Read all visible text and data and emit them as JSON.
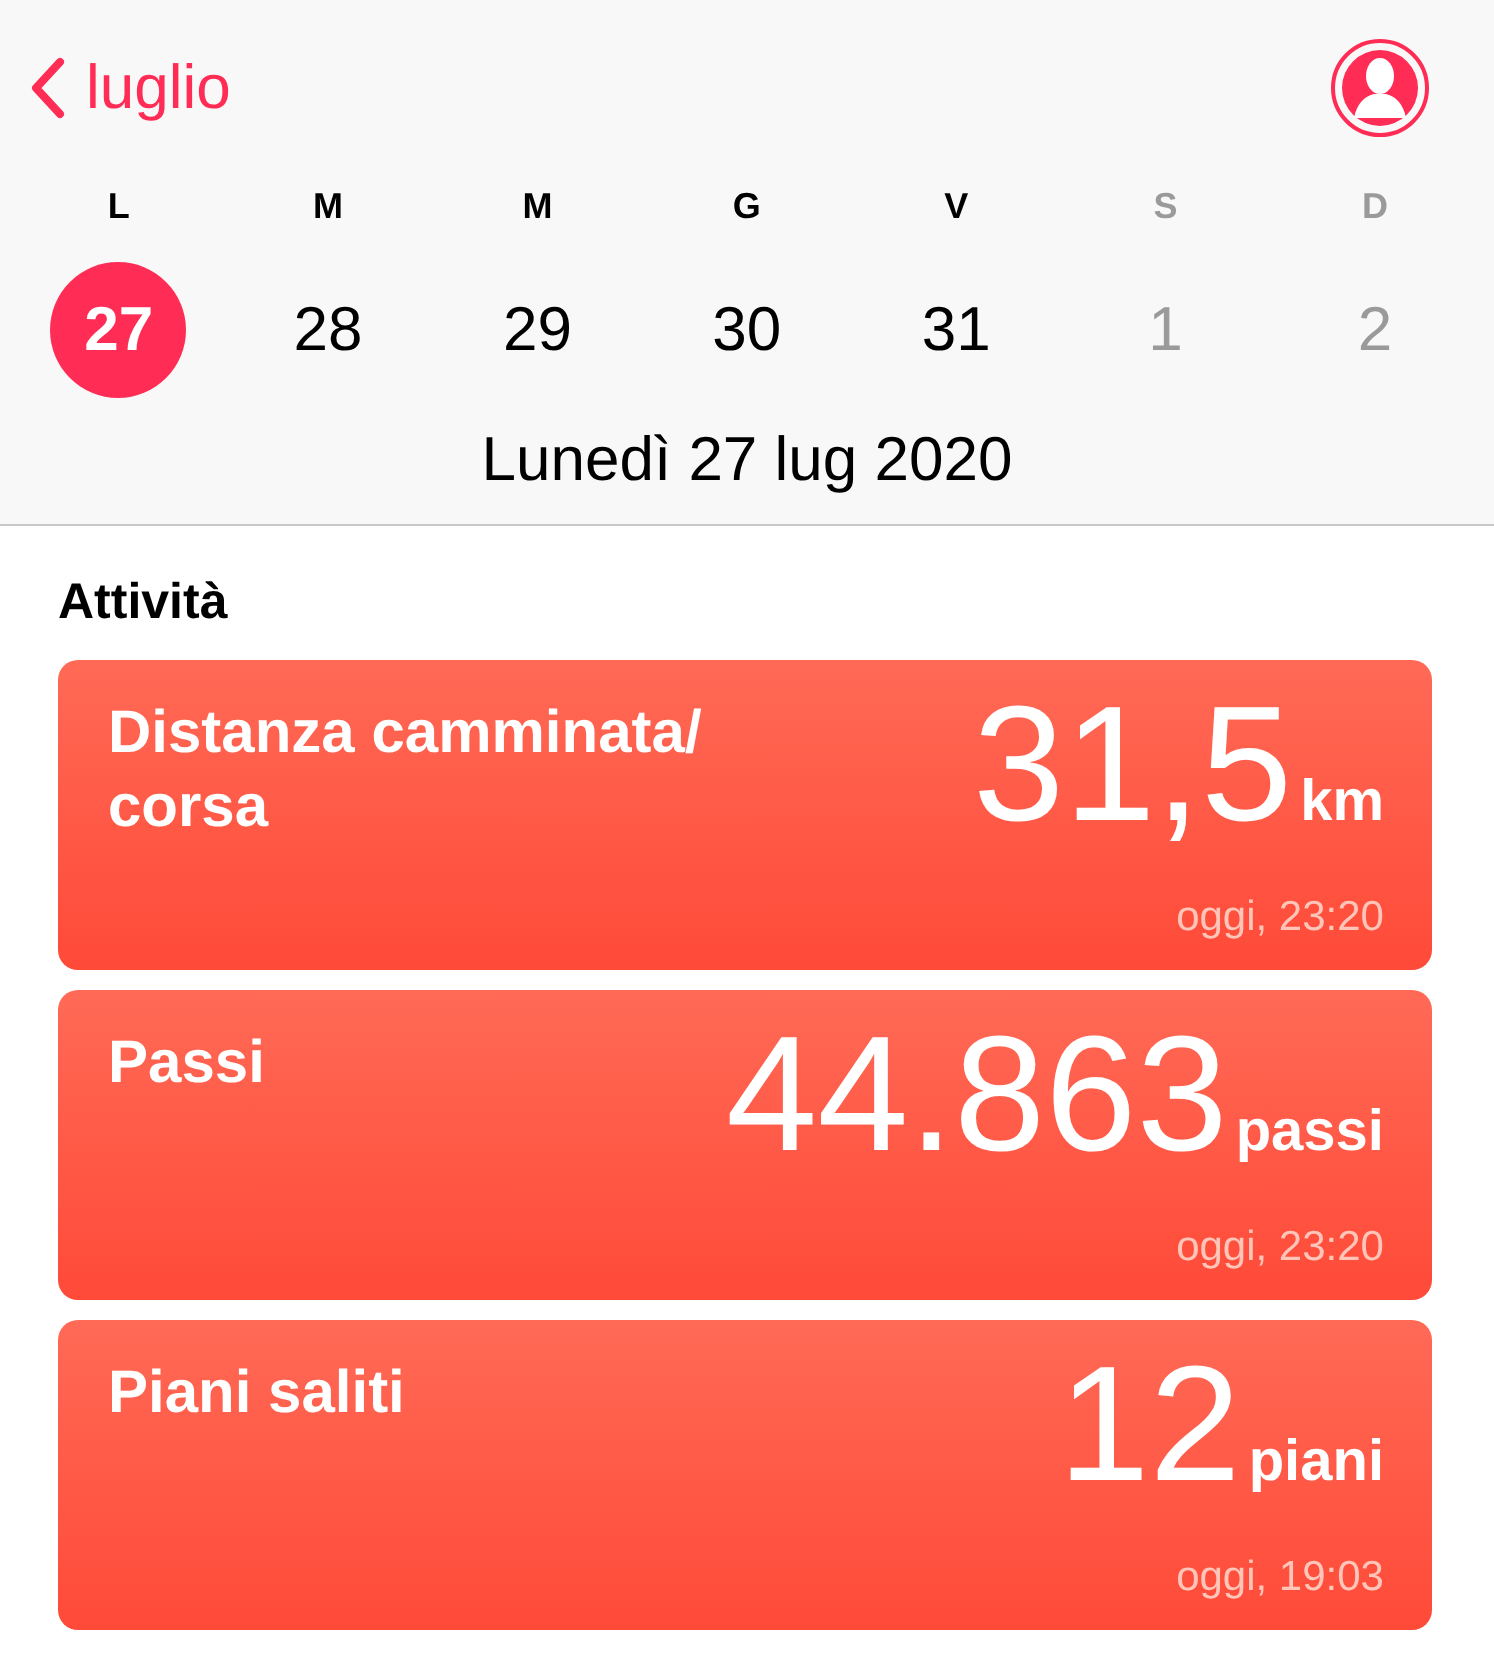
{
  "nav": {
    "back_label": "luglio"
  },
  "week": [
    {
      "weekday": "L",
      "day": "27",
      "selected": true,
      "dimmed": false
    },
    {
      "weekday": "M",
      "day": "28",
      "selected": false,
      "dimmed": false
    },
    {
      "weekday": "M",
      "day": "29",
      "selected": false,
      "dimmed": false
    },
    {
      "weekday": "G",
      "day": "30",
      "selected": false,
      "dimmed": false
    },
    {
      "weekday": "V",
      "day": "31",
      "selected": false,
      "dimmed": false
    },
    {
      "weekday": "S",
      "day": "1",
      "selected": false,
      "dimmed": true
    },
    {
      "weekday": "D",
      "day": "2",
      "selected": false,
      "dimmed": true
    }
  ],
  "date_label": "Lunedì 27 lug 2020",
  "section_title": "Attività",
  "cards": [
    {
      "title_lines": [
        "Distanza camminata/",
        "corsa"
      ],
      "value": "31,5",
      "unit": "km",
      "time": "oggi, 23:20"
    },
    {
      "title_lines": [
        "Passi"
      ],
      "value": "44.863",
      "unit": "passi",
      "time": "oggi, 23:20"
    },
    {
      "title_lines": [
        "Piani saliti"
      ],
      "value": "12",
      "unit": "piani",
      "time": "oggi, 19:03"
    }
  ]
}
